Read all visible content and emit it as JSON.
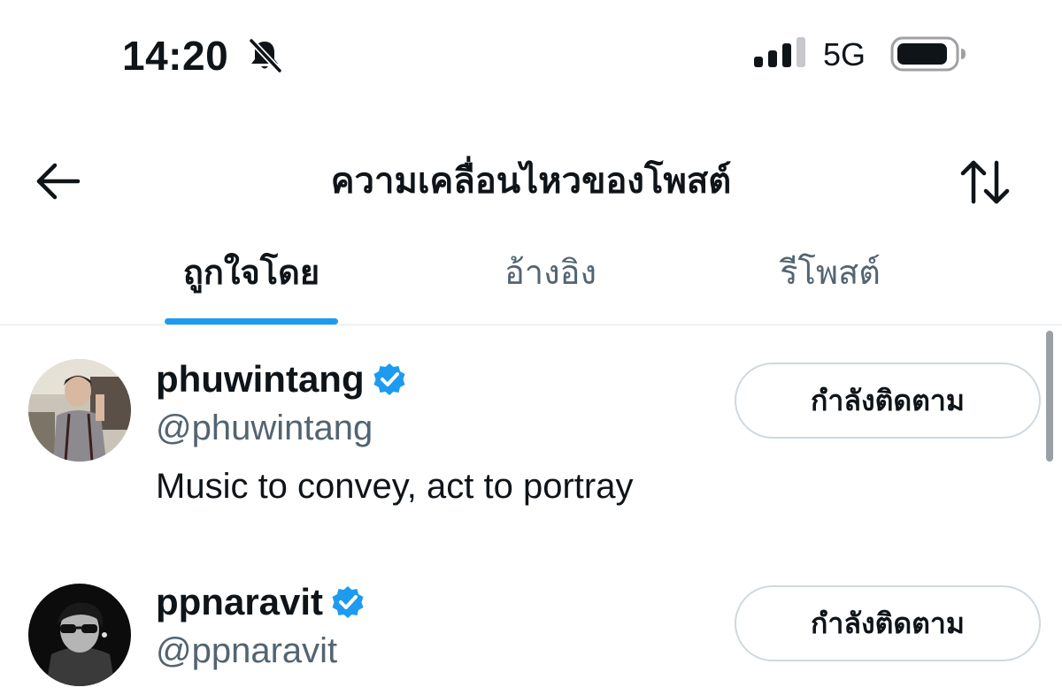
{
  "status_bar": {
    "time": "14:20",
    "network": "5G",
    "icons": [
      "bell-off-icon",
      "signal-icon",
      "battery-icon"
    ]
  },
  "header": {
    "title": "ความเคลื่อนไหวของโพสต์",
    "back_icon": "arrow-left-icon",
    "sort_icon": "sort-arrows-icon"
  },
  "tabs": [
    {
      "label": "ถูกใจโดย",
      "active": true
    },
    {
      "label": "อ้างอิง",
      "active": false
    },
    {
      "label": "รีโพสต์",
      "active": false
    }
  ],
  "colors": {
    "accent": "#1d9bf0",
    "text": "#0f1419",
    "secondary_text": "#536471",
    "border": "#cfd9de"
  },
  "users": [
    {
      "name": "phuwintang",
      "handle": "@phuwintang",
      "bio": "Music to convey, act to portray",
      "verified": true,
      "follow_label": "กำลังติดตาม"
    },
    {
      "name": "ppnaravit",
      "handle": "@ppnaravit",
      "bio": "",
      "verified": true,
      "follow_label": "กำลังติดตาม"
    }
  ]
}
